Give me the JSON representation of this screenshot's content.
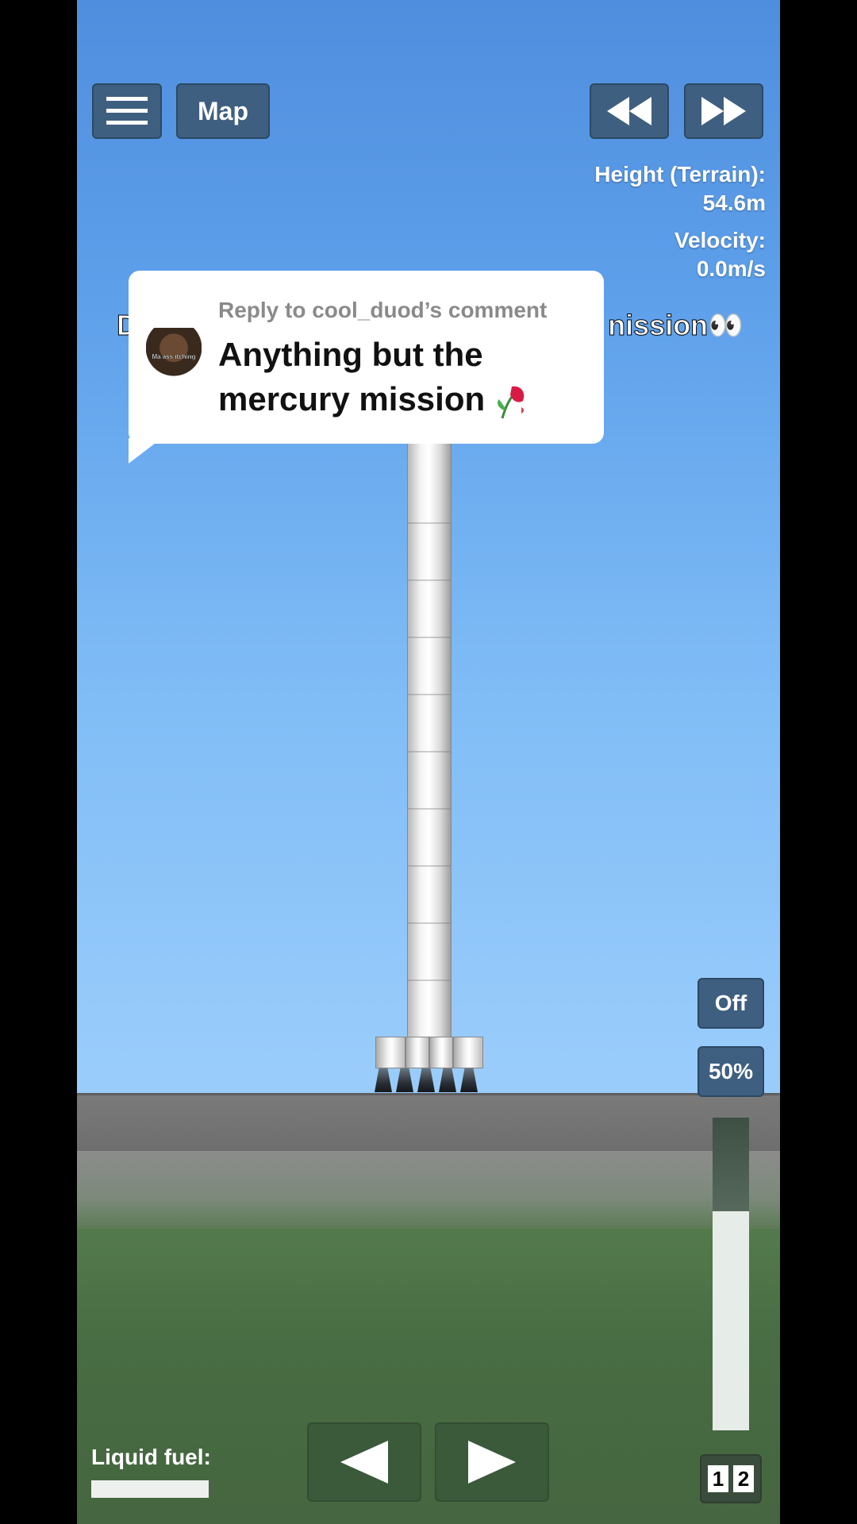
{
  "toolbar": {
    "menu_icon": "hamburger-menu-icon",
    "map_label": "Map",
    "rewind_icon": "rewind-icon",
    "fast_forward_icon": "fast-forward-icon"
  },
  "hud": {
    "height_label": "Height (Terrain):",
    "height_value": "54.6m",
    "velocity_label": "Velocity:",
    "velocity_value": "0.0m/s"
  },
  "comment": {
    "reply_label": "Reply to cool_duod’s comment",
    "line1": "Anything but the",
    "line2": "mercury mission",
    "emoji_icon": "wilted-flower-icon",
    "avatar_caption": "Ma ass itching",
    "overlay_left": "D",
    "overlay_right": "nission👀"
  },
  "controls": {
    "engine_toggle_label": "Off",
    "throttle_label": "50%",
    "throttle_fraction": 0.7,
    "stage_left_icon": "triangle-left-icon",
    "stage_right_icon": "triangle-right-icon",
    "stage_1": "1",
    "stage_2": "2"
  },
  "fuel": {
    "label": "Liquid fuel:",
    "fraction": 1.0
  },
  "colors": {
    "button_bg": "#3e5f80",
    "sky_top": "#4f8ede",
    "ground": "#486c43"
  }
}
